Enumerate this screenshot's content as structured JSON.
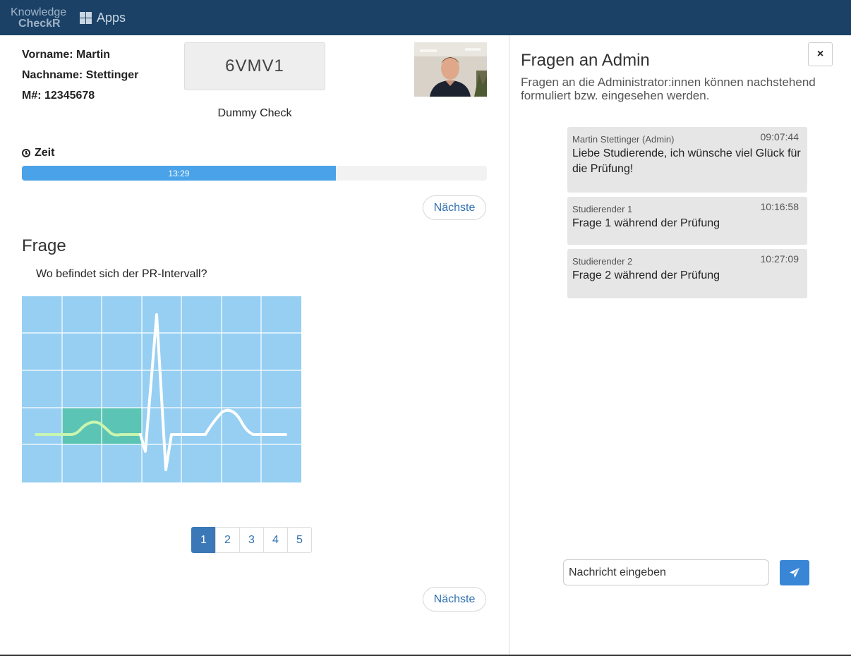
{
  "header": {
    "logo_line1": "Knowledge",
    "logo_line2": "CheckR",
    "apps_icon": "grid-icon",
    "apps_label": "Apps"
  },
  "student": {
    "firstname_line": "Vorname: Martin",
    "lastname_line": "Nachname: Stettinger",
    "matrikel_line": "M#: 12345678",
    "code": "6VMV1",
    "check_name": "Dummy Check"
  },
  "timer": {
    "label": "Zeit",
    "icon": "clock-icon",
    "remaining": "13:29",
    "progress_fraction": 0.675,
    "color": "#4aa3e8"
  },
  "nav": {
    "next_label_top": "Nächste",
    "next_label_bottom": "Nächste"
  },
  "question": {
    "heading": "Frage",
    "text": "Wo befindet sich der PR-Intervall?"
  },
  "pagination": {
    "pages": [
      "1",
      "2",
      "3",
      "4",
      "5"
    ],
    "active": "1"
  },
  "admin_panel": {
    "title": "Fragen an Admin",
    "subtitle": "Fragen an die Administrator:innen können nachstehend formuliert bzw. eingesehen werden.",
    "close_label": "×",
    "messages": [
      {
        "sender": "Martin Stettinger (Admin)",
        "time": "09:07:44",
        "text": "Liebe Studierende, ich wünsche viel Glück für die Prüfung!"
      },
      {
        "sender": "Studierender 1",
        "time": "10:16:58",
        "text": "Frage 1 während der Prüfung"
      },
      {
        "sender": "Studierender 2",
        "time": "10:27:09",
        "text": "Frage 2 während der Prüfung"
      }
    ],
    "input_placeholder": "Nachricht eingeben",
    "send_icon": "send-icon"
  },
  "colors": {
    "topbar": "#1b4167",
    "accent": "#3a78b7",
    "ecg_background": "#96cff2",
    "ecg_highlight": "#5cc4b4"
  }
}
